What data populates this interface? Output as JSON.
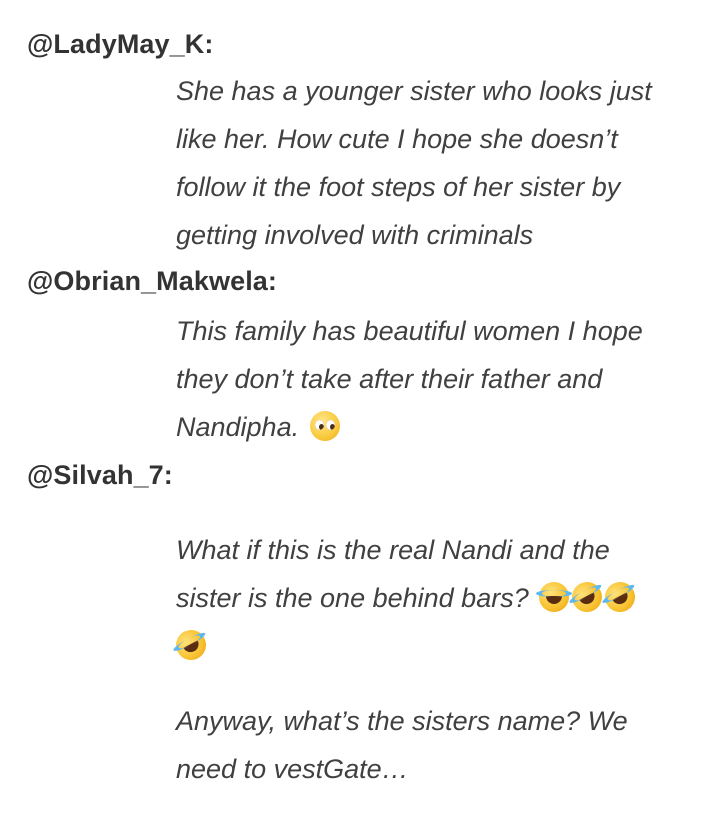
{
  "comments": [
    {
      "username": "@LadyMay_K:",
      "lines": [
        "She has a younger sister who looks just",
        "like her. How cute I hope she doesn’t",
        "follow it the foot steps of her sister by",
        "getting involved with criminals"
      ]
    },
    {
      "username": "@Obrian_Makwela:",
      "lines": [
        "This family has beautiful women I hope",
        "they don’t take after their father and",
        "Nandipha."
      ],
      "emoji": [
        "pleading-face-icon"
      ]
    },
    {
      "username": "@Silvah_7:",
      "paragraph1": {
        "lines": [
          "What if this is the real Nandi and the",
          "sister is the one behind bars?"
        ],
        "emoji": [
          "tears-of-joy-icon",
          "rolling-on-floor-laughing-icon",
          "rolling-on-floor-laughing-icon",
          "rolling-on-floor-laughing-icon"
        ]
      },
      "paragraph2": {
        "lines": [
          "Anyway, what’s the sisters name? We",
          "need to vestGate…"
        ]
      }
    }
  ],
  "colors": {
    "background": "#ffffff",
    "username_text": "#333333",
    "body_text": "#404040"
  }
}
